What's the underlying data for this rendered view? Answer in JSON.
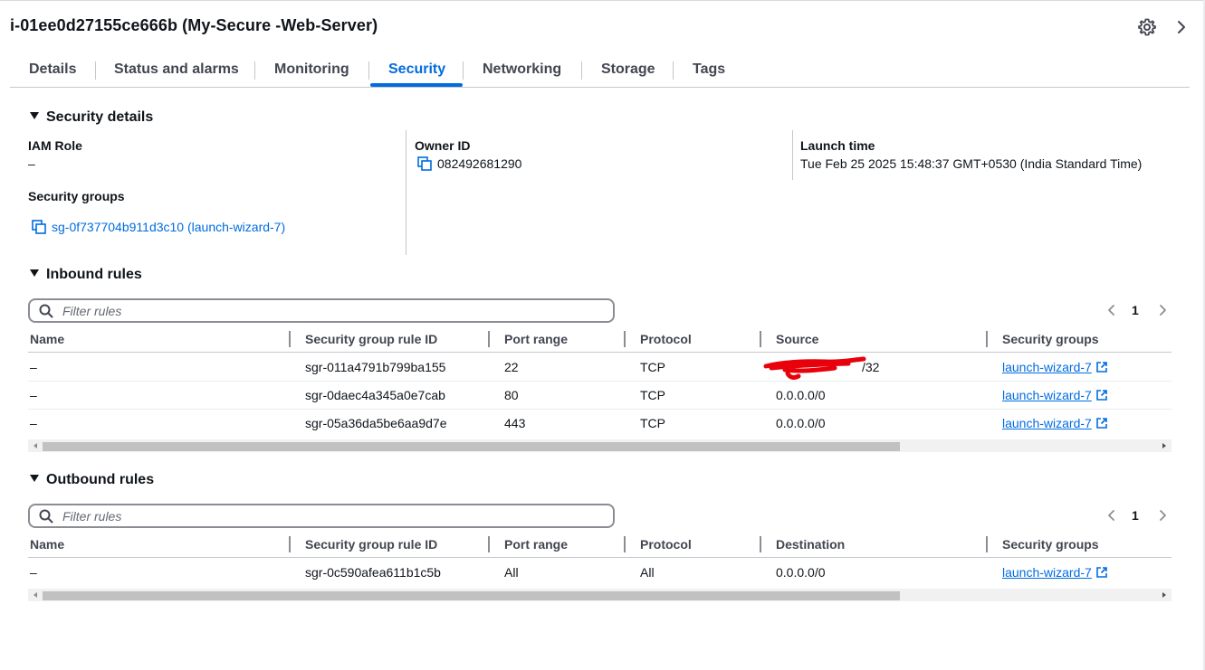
{
  "instance": {
    "title": "i-01ee0d27155ce666b (My-Secure -Web-Server)"
  },
  "tabs": [
    {
      "label": "Details",
      "active": false
    },
    {
      "label": "Status and alarms",
      "active": false
    },
    {
      "label": "Monitoring",
      "active": false
    },
    {
      "label": "Security",
      "active": true
    },
    {
      "label": "Networking",
      "active": false
    },
    {
      "label": "Storage",
      "active": false
    },
    {
      "label": "Tags",
      "active": false
    }
  ],
  "security_details": {
    "heading": "Security details",
    "iam_role_label": "IAM Role",
    "iam_role_value": "–",
    "security_groups_label": "Security groups",
    "security_group_link": "sg-0f737704b911d3c10 (launch-wizard-7)",
    "owner_id_label": "Owner ID",
    "owner_id_value": "082492681290",
    "launch_time_label": "Launch time",
    "launch_time_value": "Tue Feb 25 2025 15:48:37 GMT+0530 (India Standard Time)"
  },
  "inbound": {
    "heading": "Inbound rules",
    "filter_placeholder": "Filter rules",
    "page": "1",
    "columns": [
      "Name",
      "Security group rule ID",
      "Port range",
      "Protocol",
      "Source",
      "Security groups"
    ],
    "rows": [
      {
        "name": "–",
        "rule_id": "sgr-011a4791b799ba155",
        "port": "22",
        "protocol": "TCP",
        "source": "/32",
        "sg": "launch-wizard-7"
      },
      {
        "name": "–",
        "rule_id": "sgr-0daec4a345a0e7cab",
        "port": "80",
        "protocol": "TCP",
        "source": "0.0.0.0/0",
        "sg": "launch-wizard-7"
      },
      {
        "name": "–",
        "rule_id": "sgr-05a36da5be6aa9d7e",
        "port": "443",
        "protocol": "TCP",
        "source": "0.0.0.0/0",
        "sg": "launch-wizard-7"
      }
    ]
  },
  "outbound": {
    "heading": "Outbound rules",
    "filter_placeholder": "Filter rules",
    "page": "1",
    "columns": [
      "Name",
      "Security group rule ID",
      "Port range",
      "Protocol",
      "Destination",
      "Security groups"
    ],
    "rows": [
      {
        "name": "–",
        "rule_id": "sgr-0c590afea611b1c5b",
        "port": "All",
        "protocol": "All",
        "destination": "0.0.0.0/0",
        "sg": "launch-wizard-7"
      }
    ]
  },
  "colors": {
    "accent": "#006ce0",
    "text": "#0f141a",
    "secondary_text": "#424650",
    "redaction": "#e8000b"
  },
  "icons": {
    "settings": "gear-icon",
    "expand": "chevron-right-icon",
    "copy": "copy-icon",
    "external": "external-link-icon",
    "search": "search-icon",
    "caret": "caret-down-icon"
  }
}
